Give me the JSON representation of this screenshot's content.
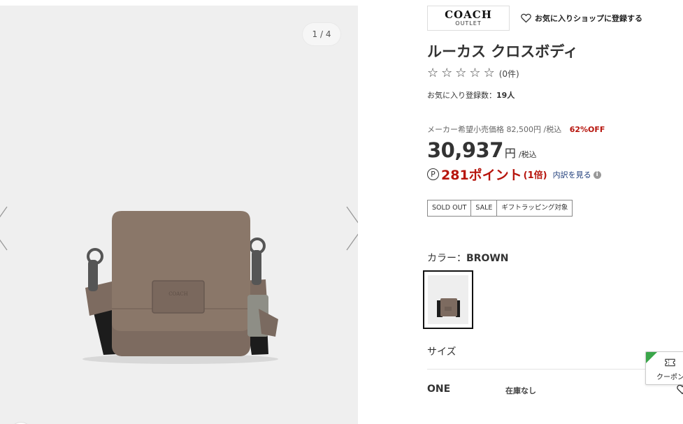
{
  "gallery": {
    "counter": "1 / 4",
    "bag_logo_text": "COACH"
  },
  "brand": {
    "logo_main": "COACH",
    "logo_sub": "OUTLET",
    "fav_shop_label": "お気に入りショップに登録する"
  },
  "product": {
    "title": "ルーカス クロスボディ",
    "star_glyph": "☆",
    "review_count": "(0件)",
    "fav_count_label": "お気に入り登録数：",
    "fav_count_value": "19人",
    "list_price": "メーカー希望小売価格 82,500円 /税込",
    "discount": "62%OFF",
    "price": "30,937",
    "price_unit": "円",
    "price_tax": "/税込",
    "point_symbol": "P",
    "points": "281ポイント",
    "points_multiplier": "(1倍)",
    "points_link": "内訳を見る",
    "tags": [
      "SOLD OUT",
      "SALE",
      "ギフトラッピング対象"
    ]
  },
  "color": {
    "label": "カラー：",
    "value": "BROWN"
  },
  "size": {
    "label": "サイズ",
    "option": "ONE",
    "stock": "在庫なし"
  },
  "coupon": {
    "label": "クーポン"
  },
  "colors": {
    "accent_red": "#b7150d",
    "link_blue": "#1e3c7a",
    "coupon_green": "#3aa64a",
    "bag_taupe": "#7d6b60"
  },
  "icons": [
    "chevron-left-icon",
    "chevron-right-icon",
    "heart-icon",
    "info-icon",
    "point-icon",
    "coupon-icon",
    "star-icon"
  ]
}
